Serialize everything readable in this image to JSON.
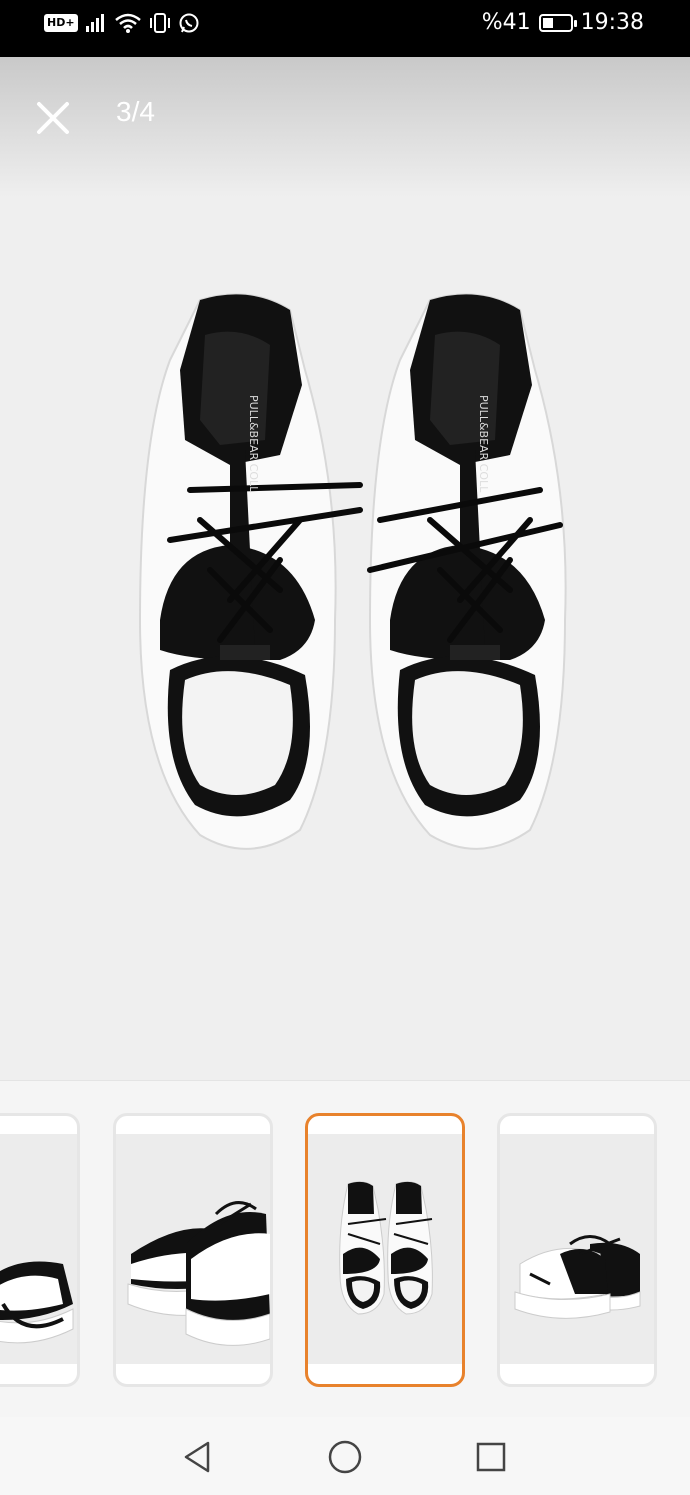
{
  "status_bar": {
    "hd_label": "HD+",
    "battery_text": "%41",
    "battery_level": 0.41,
    "time": "19:38",
    "icons": [
      "signal-icon",
      "wifi-icon",
      "vibrate-icon",
      "whatsapp-icon",
      "battery-charging-icon"
    ]
  },
  "viewer": {
    "counter": "3/4",
    "close_icon": "close-icon",
    "brand_text": "PULL&BEAR COLL"
  },
  "thumbnails": {
    "active_index": 2,
    "accent_color": "#e8822c",
    "items": [
      "thumbnail-1",
      "thumbnail-2",
      "thumbnail-3",
      "thumbnail-4"
    ]
  },
  "nav_bar": {
    "icons": [
      "back-triangle-icon",
      "home-circle-icon",
      "recents-square-icon"
    ]
  }
}
